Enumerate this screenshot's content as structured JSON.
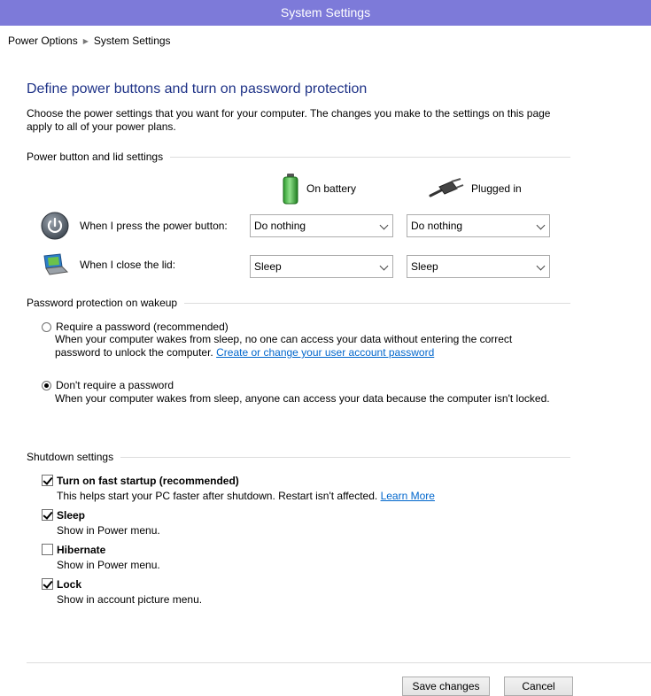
{
  "window": {
    "title": "System Settings"
  },
  "breadcrumb": {
    "items": [
      "Power Options",
      "System Settings"
    ]
  },
  "page": {
    "title": "Define power buttons and turn on password protection",
    "intro": "Choose the power settings that you want for your computer. The changes you make to the settings on this page apply to all of your power plans."
  },
  "power_section": {
    "header": "Power button and lid settings",
    "columns": {
      "battery": "On battery",
      "plugged": "Plugged in"
    },
    "rows": [
      {
        "label": "When I press the power button:",
        "battery_value": "Do nothing",
        "plugged_value": "Do nothing"
      },
      {
        "label": "When I close the lid:",
        "battery_value": "Sleep",
        "plugged_value": "Sleep"
      }
    ]
  },
  "password_section": {
    "header": "Password protection on wakeup",
    "options": [
      {
        "label": "Require a password (recommended)",
        "selected": false,
        "desc": "When your computer wakes from sleep, no one can access your data without entering the correct password to unlock the computer.",
        "link": "Create or change your user account password"
      },
      {
        "label": "Don't require a password",
        "selected": true,
        "desc": "When your computer wakes from sleep, anyone can access your data because the computer isn't locked."
      }
    ]
  },
  "shutdown_section": {
    "header": "Shutdown settings",
    "items": [
      {
        "label": "Turn on fast startup (recommended)",
        "checked": true,
        "desc": "This helps start your PC faster after shutdown. Restart isn't affected.",
        "link": "Learn More"
      },
      {
        "label": "Sleep",
        "checked": true,
        "desc": "Show in Power menu."
      },
      {
        "label": "Hibernate",
        "checked": false,
        "desc": "Show in Power menu."
      },
      {
        "label": "Lock",
        "checked": true,
        "desc": "Show in account picture menu."
      }
    ]
  },
  "footer": {
    "save_label": "Save changes",
    "cancel_label": "Cancel"
  },
  "colors": {
    "titlebar": "#7d7ad9",
    "title_text": "#1e3287",
    "link": "#0066cc"
  }
}
